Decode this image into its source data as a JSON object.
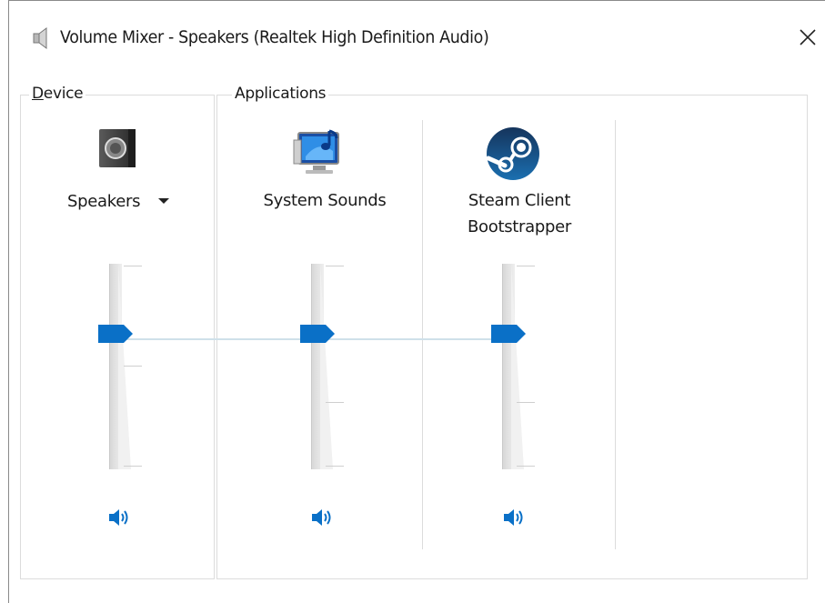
{
  "window": {
    "title": "Volume Mixer - Speakers (Realtek High Definition Audio)",
    "close_glyph": "✕"
  },
  "icons": {
    "titlebar": "speaker-volume-icon",
    "device": "speaker-device-icon",
    "system_sounds": "system-sounds-icon",
    "steam": "steam-icon",
    "mute": "speaker-sound-on-icon"
  },
  "device": {
    "group_label": "Device",
    "selected": "Speakers",
    "volume_percent": 66
  },
  "applications": {
    "group_label": "Applications",
    "items": [
      {
        "label": "System Sounds",
        "volume_percent": 66
      },
      {
        "label_line1": "Steam Client",
        "label_line2": "Bootstrapper",
        "volume_percent": 66
      }
    ]
  },
  "colors": {
    "accent": "#0a70c7",
    "link_line": "#cfe0ea",
    "track": "#dcdcdc"
  }
}
